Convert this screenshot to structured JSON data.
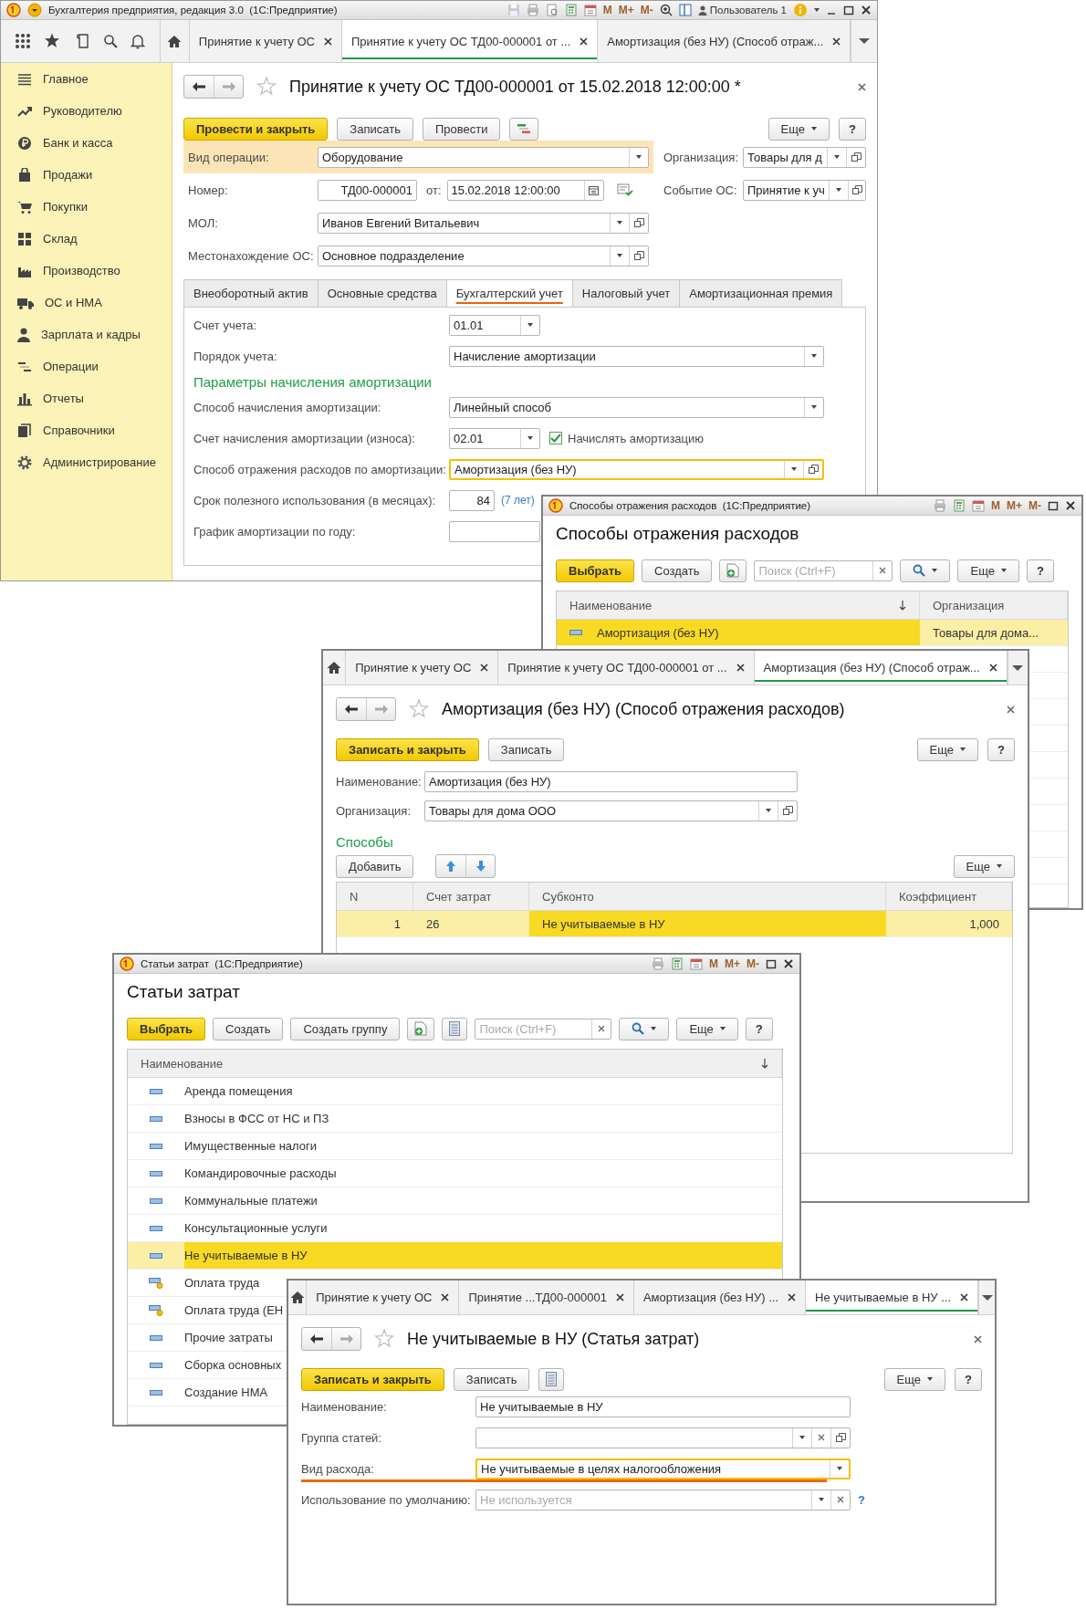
{
  "main_window": {
    "title": "Бухгалтерия предприятия, редакция 3.0  (1С:Предприятие)",
    "memory_buttons": [
      "M",
      "M+",
      "M-"
    ],
    "user": "Пользователь 1",
    "open_tabs": [
      {
        "label": "Принятие к учету ОС",
        "selected": false
      },
      {
        "label": "Принятие к учету ОС ТД00-000001 от ...",
        "selected": true
      },
      {
        "label": "Амортизация (без НУ) (Способ отраж...",
        "selected": false
      }
    ],
    "sidebar": [
      "Главное",
      "Руководителю",
      "Банк и касса",
      "Продажи",
      "Покупки",
      "Склад",
      "Производство",
      "ОС и НМА",
      "Зарплата и кадры",
      "Операции",
      "Отчеты",
      "Справочники",
      "Администрирование"
    ],
    "document": {
      "title": "Принятие к учету ОС ТД00-000001 от 15.02.2018 12:00:00 *",
      "buttons": [
        {
          "label": "Провести и закрыть",
          "primary": true
        },
        {
          "label": "Записать",
          "primary": false
        },
        {
          "label": "Провести",
          "primary": false
        }
      ],
      "more": "Еще",
      "help": "?",
      "operation": {
        "label": "Вид операции:",
        "value": "Оборудование"
      },
      "organization": {
        "label": "Организация:",
        "value": "Товары для д"
      },
      "number": {
        "label": "Номер:",
        "value": "ТД00-000001"
      },
      "date": {
        "label": "от:",
        "value": "15.02.2018 12:00:00"
      },
      "event": {
        "label": "Событие ОС:",
        "value": "Принятие к уч"
      },
      "mol": {
        "label": "МОЛ:",
        "value": "Иванов Евгений Витальевич"
      },
      "location": {
        "label": "Местонахождение ОС:",
        "value": "Основное подразделение"
      },
      "tabs": [
        {
          "label": "Внеоборотный актив",
          "selected": false
        },
        {
          "label": "Основные средства",
          "selected": false
        },
        {
          "label": "Бухгалтерский учет",
          "selected": true
        },
        {
          "label": "Налоговый учет",
          "selected": false
        },
        {
          "label": "Амортизационная премия",
          "selected": false
        }
      ],
      "accounting": [
        {
          "kind": "select_short",
          "label": "Счет учета:",
          "value": "01.01",
          "focused": false
        },
        {
          "kind": "select",
          "label": "Порядок учета:",
          "value": "Начисление амортизации",
          "focused": false
        },
        {
          "kind": "heading",
          "label": "Параметры начисления амортизации"
        },
        {
          "kind": "select",
          "label": "Способ начисления амортизации:",
          "value": "Линейный способ",
          "focused": false
        },
        {
          "kind": "select_short",
          "label": "Счет начисления амортизации (износа):",
          "value": "02.01",
          "focused": false,
          "checkbox": {
            "label": "Начислять амортизацию",
            "checked": true
          }
        },
        {
          "kind": "select_open",
          "label": "Способ отражения расходов по амортизации:",
          "value": "Амортизация (без НУ)",
          "focused": true
        },
        {
          "kind": "number",
          "label": "Срок полезного использования (в месяцах):",
          "value": "84",
          "focused": false,
          "note": "(7 лет)"
        },
        {
          "kind": "input",
          "label": "График амортизации по году:",
          "focused": false
        }
      ]
    }
  },
  "expense_methods_window": {
    "title": "Способы отражения расходов  (1С:Предприятие)",
    "memory_buttons": [
      "M",
      "M+",
      "M-"
    ],
    "heading": "Способы отражения расходов",
    "select_button": "Выбрать",
    "create_button": "Создать",
    "search": {
      "placeholder": "Поиск (Ctrl+F)"
    },
    "more": "Еще",
    "help": "?",
    "columns": [
      "Наименование",
      "Организация"
    ],
    "rows": [
      {
        "name": "Амортизация (без НУ)",
        "organization": "Товары для дома...",
        "selected": true
      }
    ]
  },
  "expense_method_form": {
    "open_tabs": [
      {
        "label": "Принятие к учету ОС",
        "selected": false
      },
      {
        "label": "Принятие к учету ОС ТД00-000001 от ...",
        "selected": false
      },
      {
        "label": "Амортизация (без НУ) (Способ отраж...",
        "selected": true
      }
    ],
    "title": "Амортизация (без НУ) (Способ отражения расходов)",
    "buttons": [
      {
        "label": "Записать и закрыть",
        "primary": true
      },
      {
        "label": "Записать",
        "primary": false
      }
    ],
    "more": "Еще",
    "help": "?",
    "name": {
      "label": "Наименование:",
      "value": "Амортизация (без НУ)"
    },
    "organization": {
      "label": "Организация:",
      "value": "Товары для дома ООО"
    },
    "section": "Способы",
    "add_button": "Добавить",
    "table_more": "Еще",
    "columns": [
      "N",
      "Счет затрат",
      "Субконто",
      "Коэффициент"
    ],
    "rows": [
      {
        "n": "1",
        "account": "26",
        "subconto": "Не учитываемые в НУ",
        "coefficient": "1,000",
        "selected": true
      }
    ]
  },
  "cost_items_window": {
    "title": "Статьи затрат  (1С:Предприятие)",
    "memory_buttons": [
      "M",
      "M+",
      "M-"
    ],
    "heading": "Статьи затрат",
    "select_button": "Выбрать",
    "create_button": "Создать",
    "create_group_button": "Создать группу",
    "search": {
      "placeholder": "Поиск (Ctrl+F)"
    },
    "more": "Еще",
    "help": "?",
    "column": "Наименование",
    "items": [
      {
        "name": "Аренда помещения",
        "kind": "item",
        "selected": false
      },
      {
        "name": "Взносы в ФСС от НС и ПЗ",
        "kind": "item",
        "selected": false
      },
      {
        "name": "Имущественные налоги",
        "kind": "item",
        "selected": false
      },
      {
        "name": "Командировочные расходы",
        "kind": "item",
        "selected": false
      },
      {
        "name": "Коммунальные платежи",
        "kind": "item",
        "selected": false
      },
      {
        "name": "Консультационные услуги",
        "kind": "item",
        "selected": false
      },
      {
        "name": "Не учитываемые в НУ",
        "kind": "item",
        "selected": true
      },
      {
        "name": "Оплата труда",
        "kind": "predefined",
        "selected": false
      },
      {
        "name": "Оплата труда (ЕН",
        "kind": "predefined",
        "selected": false
      },
      {
        "name": "Прочие затраты",
        "kind": "item",
        "selected": false
      },
      {
        "name": "Сборка основных",
        "kind": "item",
        "selected": false
      },
      {
        "name": "Создание НМА",
        "kind": "item",
        "selected": false
      }
    ]
  },
  "cost_item_form": {
    "open_tabs": [
      {
        "label": "Принятие к учету ОС",
        "selected": false
      },
      {
        "label": "Принятие ...ТД00-000001",
        "selected": false
      },
      {
        "label": "Амортизация (без НУ) ...",
        "selected": false
      },
      {
        "label": "Не учитываемые в НУ ...",
        "selected": true
      }
    ],
    "title": "Не учитываемые в НУ (Статья затрат)",
    "buttons": [
      {
        "label": "Записать и закрыть",
        "primary": true
      },
      {
        "label": "Записать",
        "primary": false
      }
    ],
    "more": "Еще",
    "help": "?",
    "fields": [
      {
        "kind": "text",
        "label": "Наименование:",
        "value": "Не учитываемые в НУ",
        "focused": false,
        "underlined": false
      },
      {
        "kind": "select_clear_open",
        "label": "Группа статей:",
        "focused": false,
        "underlined": false
      },
      {
        "kind": "select",
        "label": "Вид расхода:",
        "value": "Не учитываемые в целях налогообложения",
        "focused": true,
        "underlined": true
      },
      {
        "kind": "select_clear",
        "label": "Использование по умолчанию:",
        "placeholder": "Не используется",
        "focused": false,
        "underlined": false,
        "hint": "?"
      }
    ]
  }
}
